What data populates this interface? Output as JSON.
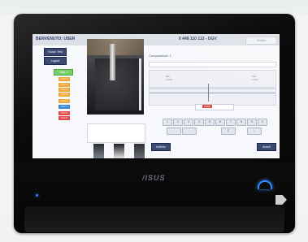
{
  "header": {
    "user_label": "BENVENUTO: USER",
    "code_title": "0 448 110 113 - DGV",
    "right_button": "Fisible"
  },
  "sidebar": {
    "buttons": [
      "Nuovo Test",
      "Logout"
    ],
    "ref_label": "Test 1",
    "steps": [
      {
        "label": "Test 2",
        "color": "#f1a93a"
      },
      {
        "label": "Test 3",
        "color": "#f1a93a"
      },
      {
        "label": "Test 4",
        "color": "#f1a93a"
      },
      {
        "label": "Test 5",
        "color": "#f1a93a"
      },
      {
        "label": "Test 6",
        "color": "#f1a93a"
      },
      {
        "label": "Test 7",
        "color": "#3f86d6"
      },
      {
        "label": "Test 8",
        "color": "#e24b4b"
      },
      {
        "label": "Test 9",
        "color": "#e24b4b"
      }
    ]
  },
  "comparator": {
    "label": "Comparatore: 1",
    "left_tick": "Min\n1.000",
    "right_tick": "Max\n1.000",
    "value": "0.000"
  },
  "keypad": {
    "row1": [
      "1",
      "2",
      "3",
      "4",
      "5",
      "6",
      "7",
      "8",
      "9",
      "0"
    ],
    "row2": [
      "-",
      "·",
      "C",
      "←"
    ]
  },
  "actions": {
    "left": "Indietro",
    "right": "Avanti"
  },
  "device": {
    "brand": "/ISUS"
  },
  "colors": {
    "accent_button": "#3a4a70",
    "ok_green": "#78cf6a",
    "warn_orange": "#f1a93a",
    "info_blue": "#3f86d6",
    "alert_red": "#e24b4b"
  }
}
